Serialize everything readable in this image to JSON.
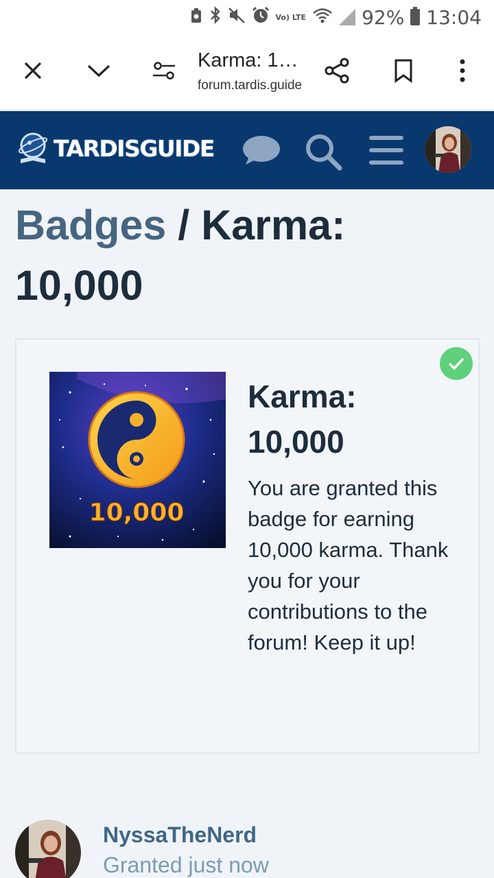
{
  "status_bar": {
    "battery": "92%",
    "time": "13:04",
    "volte_label": "Vo) LTE",
    "icons": [
      "saver-icon",
      "bluetooth-icon",
      "mute-icon",
      "alarm-icon",
      "volte-icon",
      "wifi-icon",
      "signal-icon",
      "battery-icon"
    ]
  },
  "browser": {
    "tab_title": "Karma: 1…",
    "url": "forum.tardis.guide",
    "buttons": [
      "close-icon",
      "chevron-down-icon",
      "site-settings-icon",
      "share-icon",
      "bookmark-icon",
      "more-icon"
    ]
  },
  "site": {
    "logo_text": "TARDISGUIDE",
    "header_color": "#08386e",
    "icons": [
      "chat-icon",
      "search-icon",
      "hamburger-menu-icon",
      "avatar"
    ]
  },
  "page": {
    "breadcrumb_link": "Badges",
    "separator": " / ",
    "title": "Karma: 10,000"
  },
  "badge": {
    "name": "Karma: 10,000",
    "image_label": "10,000",
    "description": "You are granted this badge for earning 10,000 karma. Thank you for your contributions to the forum! Keep it up!",
    "status_color": "#5fd07b"
  },
  "grant": {
    "username": "NyssaTheNerd",
    "granted_text": "Granted just now"
  }
}
